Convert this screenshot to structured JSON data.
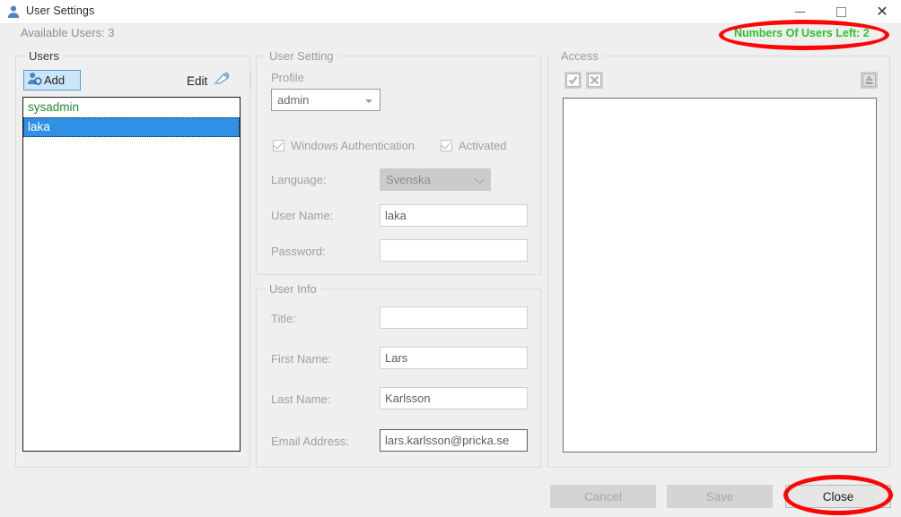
{
  "window": {
    "title": "User Settings",
    "icon": "user-icon",
    "controls": {
      "minimize": "minimize-icon",
      "maximize": "maximize-icon",
      "close": "close-icon"
    }
  },
  "status": {
    "available_users": "Available Users: 3",
    "users_left_badge": "Numbers Of Users Left: 2",
    "badge_color": "#2fc12f",
    "annotation_color": "#fb0505"
  },
  "users_panel": {
    "title": "Users",
    "add_label": "Add",
    "add_icon": "add-user-icon",
    "edit_label": "Edit",
    "edit_icon": "edit-pencil-icon",
    "list": [
      {
        "name": "sysadmin",
        "state": "green"
      },
      {
        "name": "laka",
        "state": "selected"
      }
    ]
  },
  "user_setting": {
    "title": "User Setting",
    "profile_label": "Profile",
    "profile_value": "admin",
    "windows_auth_label": "Windows Authentication",
    "windows_auth_checked": true,
    "activated_label": "Activated",
    "activated_checked": true,
    "language_label": "Language:",
    "language_value": "Svenska",
    "username_label": "User Name:",
    "username_value": "laka",
    "password_label": "Password:",
    "password_value": ""
  },
  "user_info": {
    "title": "User Info",
    "title_label": "Title:",
    "title_value": "",
    "first_name_label": "First Name:",
    "first_name_value": "Lars",
    "last_name_label": "Last Name:",
    "last_name_value": "Karlsson",
    "email_label": "Email Address:",
    "email_value": "lars.karlsson@pricka.se"
  },
  "access_panel": {
    "title": "Access",
    "check_all_icon": "check-all-icon",
    "clear_all_icon": "clear-all-icon",
    "export_icon": "export-user-icon",
    "items": []
  },
  "footer": {
    "cancel_label": "Cancel",
    "save_label": "Save",
    "close_label": "Close"
  }
}
